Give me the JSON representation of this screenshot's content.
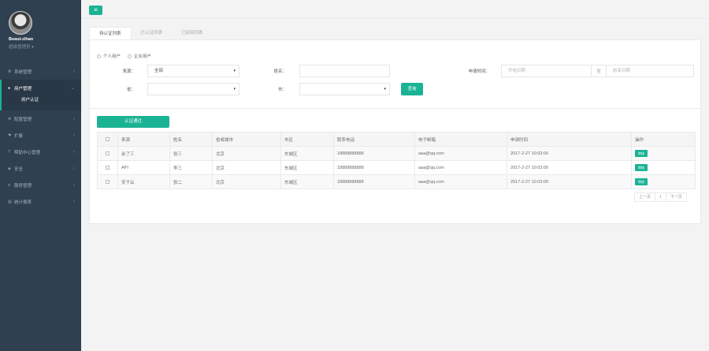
{
  "user": {
    "name": "Beaut-zihan",
    "role": "超级管理员"
  },
  "topbar": {
    "menu_icon": "bars-icon"
  },
  "sidebar": {
    "items": [
      {
        "label": "系统管理",
        "icon": "gear-icon"
      },
      {
        "label": "用户管理",
        "icon": "user-icon",
        "active": true
      },
      {
        "label": "配置管理",
        "icon": "config-icon"
      },
      {
        "label": "扩展",
        "icon": "flag-icon"
      },
      {
        "label": "帮助中心管理",
        "icon": "question-icon"
      },
      {
        "label": "安全",
        "icon": "shield-icon"
      },
      {
        "label": "服务管理",
        "icon": "list-icon"
      },
      {
        "label": "统计报表",
        "icon": "chart-icon"
      }
    ],
    "subitem": "用户认证"
  },
  "tabs": [
    "待认证列表",
    "已认证列表",
    "已驳回列表"
  ],
  "filters": {
    "radio_personal": "个人用户",
    "radio_company": "企业用户",
    "source_label": "来源：",
    "source_value": "全部",
    "name_label": "姓名：",
    "apply_time_label": "申请时间：",
    "start_date_placeholder": "开始日期",
    "to_label": "至",
    "end_date_placeholder": "结束日期",
    "province_label": "省：",
    "city_label": "市：",
    "query_button": "查询"
  },
  "approve_button": "认证通过",
  "table": {
    "headers": [
      "来源",
      "姓名",
      "省或城市",
      "市区",
      "联系电话",
      "电子邮箱",
      "申请时间",
      "操作"
    ],
    "rows": [
      {
        "source": "余了三",
        "name": "张三",
        "province": "北京",
        "district": "东城区",
        "phone": "18888888888",
        "email": "aaa@qq.com",
        "time": "2017-2-27 10:03:00",
        "action": "审核"
      },
      {
        "source": "API",
        "name": "李三",
        "province": "北京",
        "district": "东城区",
        "phone": "18888888888",
        "email": "aaa@qq.com",
        "time": "2017-2-27 10:03:00",
        "action": "审核"
      },
      {
        "source": "安子云",
        "name": "张二",
        "province": "北京",
        "district": "东城区",
        "phone": "18888888888",
        "email": "aaa@qq.com",
        "time": "2017-2-27 10:03:00",
        "action": "审核"
      }
    ]
  },
  "pagination": {
    "prev": "上一页",
    "current": "1",
    "next": "下一页"
  },
  "colors": {
    "accent": "#1ab394",
    "sidebar": "#2f4050"
  }
}
